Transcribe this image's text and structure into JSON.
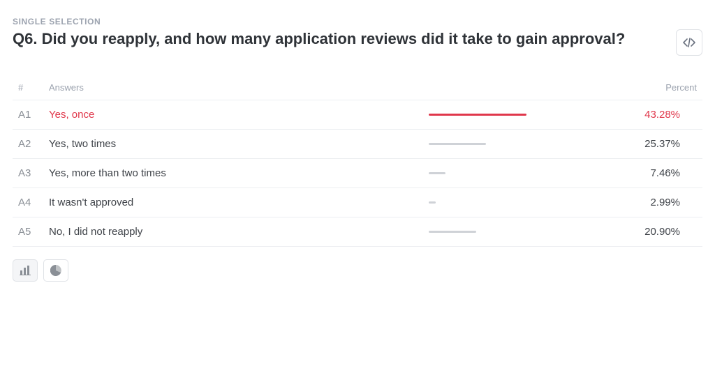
{
  "question": {
    "type_label": "SINGLE SELECTION",
    "title": "Q6. Did you reapply, and how many application reviews did it take to gain approval?"
  },
  "columns": {
    "index": "#",
    "answers": "Answers",
    "percent": "Percent"
  },
  "answers": [
    {
      "idx": "A1",
      "text": "Yes, once",
      "percent_label": "43.28%",
      "percent": 43.28,
      "highlight": true
    },
    {
      "idx": "A2",
      "text": "Yes, two times",
      "percent_label": "25.37%",
      "percent": 25.37,
      "highlight": false
    },
    {
      "idx": "A3",
      "text": "Yes, more than two times",
      "percent_label": "7.46%",
      "percent": 7.46,
      "highlight": false
    },
    {
      "idx": "A4",
      "text": "It wasn't approved",
      "percent_label": "2.99%",
      "percent": 2.99,
      "highlight": false
    },
    {
      "idx": "A5",
      "text": "No, I did not reapply",
      "percent_label": "20.90%",
      "percent": 20.9,
      "highlight": false
    }
  ],
  "icons": {
    "embed": "code-icon",
    "bar": "bar-chart-icon",
    "pie": "pie-chart-icon"
  },
  "colors": {
    "highlight": "#e0374b",
    "muted_bar": "#cfd2d7"
  },
  "chart_data": {
    "type": "bar",
    "title": "Q6. Did you reapply, and how many application reviews did it take to gain approval?",
    "categories": [
      "Yes, once",
      "Yes, two times",
      "Yes, more than two times",
      "It wasn't approved",
      "No, I did not reapply"
    ],
    "values": [
      43.28,
      25.37,
      7.46,
      2.99,
      20.9
    ],
    "xlabel": "",
    "ylabel": "Percent",
    "ylim": [
      0,
      100
    ]
  }
}
